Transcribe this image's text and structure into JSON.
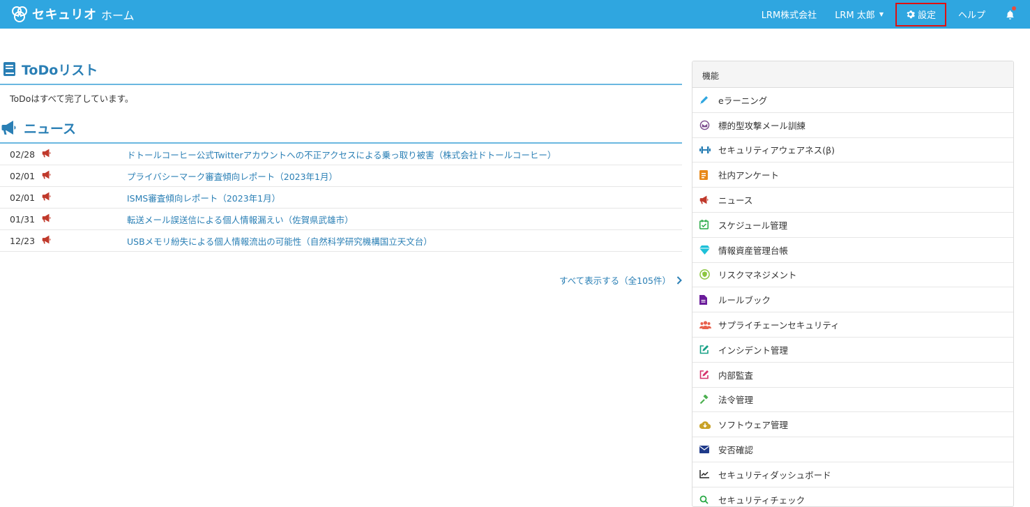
{
  "header": {
    "brand": "セキュリオ",
    "home": "ホーム",
    "company": "LRM株式会社",
    "user": "LRM 太郎",
    "settings": "設定",
    "help": "ヘルプ"
  },
  "todo": {
    "title": "ToDoリスト",
    "message": "ToDoはすべて完了しています。"
  },
  "news": {
    "title": "ニュース",
    "items": [
      {
        "date": "02/28",
        "title": "ドトールコーヒー公式Twitterアカウントへの不正アクセスによる乗っ取り被害（株式会社ドトールコーヒー）"
      },
      {
        "date": "02/01",
        "title": "プライバシーマーク審査傾向レポート（2023年1月）"
      },
      {
        "date": "02/01",
        "title": "ISMS審査傾向レポート（2023年1月）"
      },
      {
        "date": "01/31",
        "title": "転送メール誤送信による個人情報漏えい（佐賀県武雄市）"
      },
      {
        "date": "12/23",
        "title": "USBメモリ紛失による個人情報流出の可能性（自然科学研究機構国立天文台）"
      }
    ],
    "show_all": "すべて表示する（全105件）"
  },
  "features": {
    "title": "機能",
    "items": [
      {
        "label": "eラーニング",
        "icon": "pencil-icon",
        "color": "#2fa6e0"
      },
      {
        "label": "標的型攻撃メール訓練",
        "icon": "target-mail-icon",
        "color": "#7a4a8c"
      },
      {
        "label": "セキュリティアウェアネス(β)",
        "icon": "dumbbell-icon",
        "color": "#2a7fb5"
      },
      {
        "label": "社内アンケート",
        "icon": "survey-icon",
        "color": "#e8891a"
      },
      {
        "label": "ニュース",
        "icon": "megaphone-icon",
        "color": "#c0392b"
      },
      {
        "label": "スケジュール管理",
        "icon": "calendar-check-icon",
        "color": "#27a844"
      },
      {
        "label": "情報資産管理台帳",
        "icon": "diamond-icon",
        "color": "#1ec0d8"
      },
      {
        "label": "リスクマネジメント",
        "icon": "shield-icon",
        "color": "#8cc63f"
      },
      {
        "label": "ルールブック",
        "icon": "file-icon",
        "color": "#6a1b9a"
      },
      {
        "label": "サプライチェーンセキュリティ",
        "icon": "users-icon",
        "color": "#e8604c"
      },
      {
        "label": "インシデント管理",
        "icon": "edit-icon",
        "color": "#16a085"
      },
      {
        "label": "内部監査",
        "icon": "edit-icon",
        "color": "#d6336c"
      },
      {
        "label": "法令管理",
        "icon": "gavel-icon",
        "color": "#4caf50"
      },
      {
        "label": "ソフトウェア管理",
        "icon": "cloud-download-icon",
        "color": "#c9a227"
      },
      {
        "label": "安否確認",
        "icon": "envelope-icon",
        "color": "#1f3a8a"
      },
      {
        "label": "セキュリティダッシュボード",
        "icon": "line-chart-icon",
        "color": "#222222"
      },
      {
        "label": "セキュリティチェック",
        "icon": "search-icon",
        "color": "#27a844"
      }
    ]
  },
  "colors": {
    "topbar": "#2fa6e0",
    "accent": "#2a7fb5",
    "news_icon": "#c0392b",
    "highlight_border": "#e01010"
  }
}
